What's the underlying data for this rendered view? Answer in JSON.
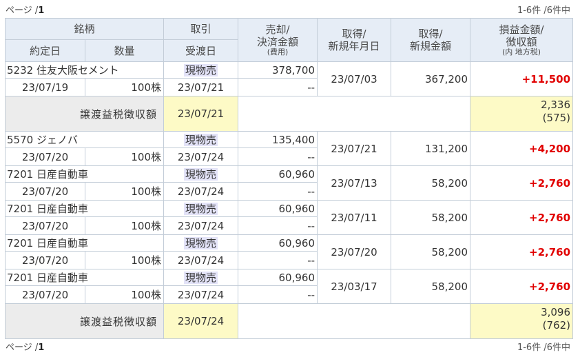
{
  "pager": {
    "prefix": "ページ /",
    "page": "1",
    "range": "1-6件 /6件中"
  },
  "headers": {
    "brand": "銘柄",
    "contract_date": "約定日",
    "quantity": "数量",
    "trade": "取引",
    "delivery_date": "受渡日",
    "sell_line1": "売却/",
    "sell_line2": "決済金額",
    "sell_sub": "(費用)",
    "acq_date_line1": "取得/",
    "acq_date_line2": "新規年月日",
    "acq_amt_line1": "取得/",
    "acq_amt_line2": "新規金額",
    "pl_line1": "損益金額/",
    "pl_line2": "徴収額",
    "pl_sub": "(内 地方税)"
  },
  "rows": [
    {
      "code_name": "5232 住友大阪セメント",
      "contract_date": "23/07/19",
      "quantity": "100株",
      "trade": "現物売",
      "delivery_date": "23/07/21",
      "sell_amount": "378,700",
      "fee": "--",
      "acq_date": "23/07/03",
      "acq_amount": "367,200",
      "pl": "+11,500"
    },
    {
      "code_name": "5570 ジェノバ",
      "contract_date": "23/07/20",
      "quantity": "100株",
      "trade": "現物売",
      "delivery_date": "23/07/24",
      "sell_amount": "135,400",
      "fee": "--",
      "acq_date": "23/07/21",
      "acq_amount": "131,200",
      "pl": "+4,200"
    },
    {
      "code_name": "7201 日産自動車",
      "contract_date": "23/07/20",
      "quantity": "100株",
      "trade": "現物売",
      "delivery_date": "23/07/24",
      "sell_amount": "60,960",
      "fee": "--",
      "acq_date": "23/07/13",
      "acq_amount": "58,200",
      "pl": "+2,760"
    },
    {
      "code_name": "7201 日産自動車",
      "contract_date": "23/07/20",
      "quantity": "100株",
      "trade": "現物売",
      "delivery_date": "23/07/24",
      "sell_amount": "60,960",
      "fee": "--",
      "acq_date": "23/07/11",
      "acq_amount": "58,200",
      "pl": "+2,760"
    },
    {
      "code_name": "7201 日産自動車",
      "contract_date": "23/07/20",
      "quantity": "100株",
      "trade": "現物売",
      "delivery_date": "23/07/24",
      "sell_amount": "60,960",
      "fee": "--",
      "acq_date": "23/07/20",
      "acq_amount": "58,200",
      "pl": "+2,760"
    },
    {
      "code_name": "7201 日産自動車",
      "contract_date": "23/07/20",
      "quantity": "100株",
      "trade": "現物売",
      "delivery_date": "23/07/24",
      "sell_amount": "60,960",
      "fee": "--",
      "acq_date": "23/03/17",
      "acq_amount": "58,200",
      "pl": "+2,760"
    }
  ],
  "tax": [
    {
      "label": "譲渡益税徴収額",
      "date": "23/07/21",
      "amount": "2,336",
      "local": "(575)"
    },
    {
      "label": "譲渡益税徴収額",
      "date": "23/07/24",
      "amount": "3,096",
      "local": "(762)"
    }
  ]
}
